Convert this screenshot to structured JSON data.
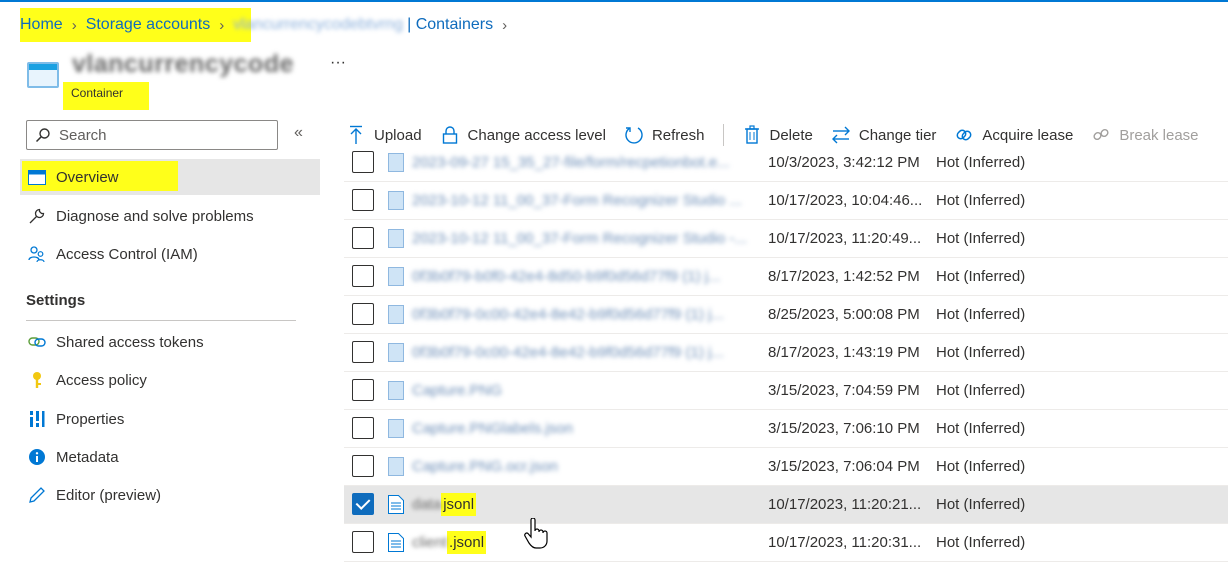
{
  "breadcrumb": {
    "home": "Home",
    "storage_accounts": "Storage accounts",
    "account_blurred": "vlancurrencycodebtvrng",
    "containers": "Containers"
  },
  "header": {
    "title_blurred": "vlancurrencycode",
    "subtitle": "Container",
    "more": "···"
  },
  "sidebar": {
    "search_placeholder": "Search",
    "collapse": "«",
    "items": [
      {
        "label": "Overview",
        "icon": "container-icon"
      },
      {
        "label": "Diagnose and solve problems",
        "icon": "wrench-icon"
      },
      {
        "label": "Access Control (IAM)",
        "icon": "people-icon"
      }
    ],
    "settings_heading": "Settings",
    "settings_items": [
      {
        "label": "Shared access tokens",
        "icon": "link-icon"
      },
      {
        "label": "Access policy",
        "icon": "key-icon"
      },
      {
        "label": "Properties",
        "icon": "properties-icon"
      },
      {
        "label": "Metadata",
        "icon": "info-icon"
      },
      {
        "label": "Editor (preview)",
        "icon": "pencil-icon"
      }
    ]
  },
  "toolbar": {
    "upload": "Upload",
    "change_access_level": "Change access level",
    "refresh": "Refresh",
    "delete": "Delete",
    "change_tier": "Change tier",
    "acquire_lease": "Acquire lease",
    "break_lease": "Break lease"
  },
  "files": [
    {
      "name": "2023-09-27 15_35_27-file/form/recpetionbot.e...",
      "modified": "10/3/2023, 3:42:12 PM",
      "tier": "Hot (Inferred)",
      "checked": false,
      "blurred": true
    },
    {
      "name": "2023-10-12 11_00_37-Form Recognizer Studio ...",
      "modified": "10/17/2023, 10:04:46...",
      "tier": "Hot (Inferred)",
      "checked": false,
      "blurred": true
    },
    {
      "name": "2023-10-12 11_00_37-Form Recognizer Studio -...",
      "modified": "10/17/2023, 11:20:49...",
      "tier": "Hot (Inferred)",
      "checked": false,
      "blurred": true
    },
    {
      "name": "0f3b0f79-b0f0-42e4-8d50-b9f0d56d77f9 (1) j...",
      "modified": "8/17/2023, 1:42:52 PM",
      "tier": "Hot (Inferred)",
      "checked": false,
      "blurred": true
    },
    {
      "name": "0f3b0f79-0c00-42e4-8e42-b9f0d56d77f9 (1) j...",
      "modified": "8/25/2023, 5:00:08 PM",
      "tier": "Hot (Inferred)",
      "checked": false,
      "blurred": true
    },
    {
      "name": "0f3b0f79-0c00-42e4-8e42-b9f0d56d77f9 (1) j...",
      "modified": "8/17/2023, 1:43:19 PM",
      "tier": "Hot (Inferred)",
      "checked": false,
      "blurred": true
    },
    {
      "name": "Capture.PNG",
      "modified": "3/15/2023, 7:04:59 PM",
      "tier": "Hot (Inferred)",
      "checked": false,
      "blurred": true
    },
    {
      "name": "Capture.PNGlabels.json",
      "modified": "3/15/2023, 7:06:10 PM",
      "tier": "Hot (Inferred)",
      "checked": false,
      "blurred": true
    },
    {
      "name": "Capture.PNG.ocr.json",
      "modified": "3/15/2023, 7:06:04 PM",
      "tier": "Hot (Inferred)",
      "checked": false,
      "blurred": true
    },
    {
      "name_prefix": "data",
      "name_suffix": "jsonl",
      "modified": "10/17/2023, 11:20:21...",
      "tier": "Hot (Inferred)",
      "checked": true,
      "blurred": false
    },
    {
      "name_prefix": "client",
      "name_suffix": ".jsonl",
      "modified": "10/17/2023, 11:20:31...",
      "tier": "Hot (Inferred)",
      "checked": false,
      "blurred": false
    }
  ]
}
